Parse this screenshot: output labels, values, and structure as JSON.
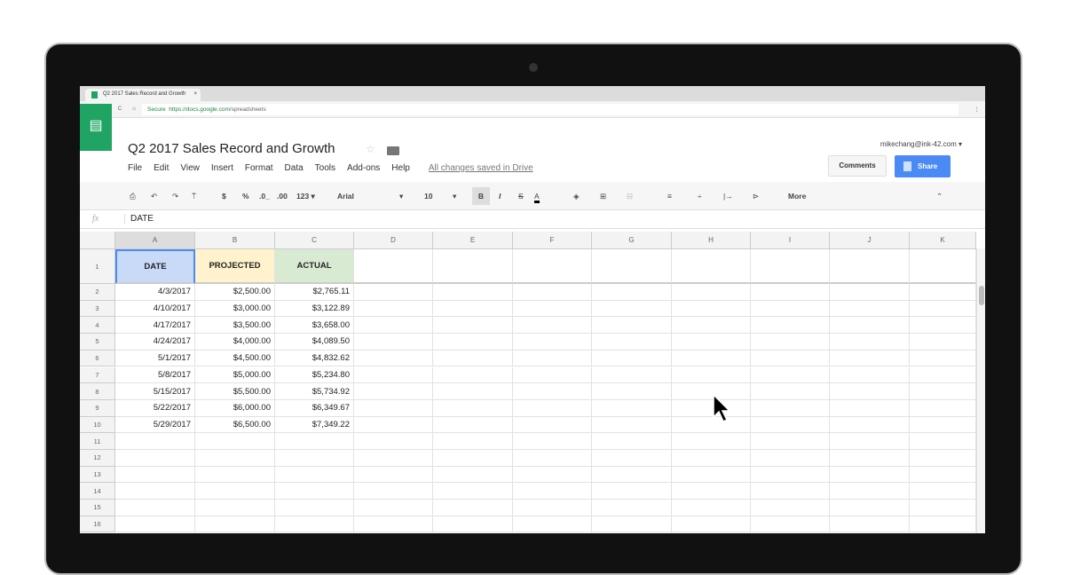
{
  "browser": {
    "tab_title": "Q2 2017 Sales Record and Growth",
    "secure": "Secure",
    "url_host": "https://docs.google.com",
    "url_path": "/spreadsheets"
  },
  "doc": {
    "title": "Q2 2017 Sales Record and Growth",
    "saved_status": "All changes saved in Drive",
    "user": "mikechang@ink-42.com",
    "comments": "Comments",
    "share": "Share"
  },
  "menus": [
    "File",
    "Edit",
    "View",
    "Insert",
    "Format",
    "Data",
    "Tools",
    "Add-ons",
    "Help"
  ],
  "toolbar": {
    "currency": "$",
    "percent": "%",
    "dec_down": ".0_",
    "dec_up": ".00",
    "format": "123 ▾",
    "font": "Arial",
    "size": "10",
    "bold": "B",
    "italic": "I",
    "strike": "S",
    "color": "A",
    "more": "More"
  },
  "formula": {
    "label": "fx",
    "value": "DATE"
  },
  "columns": [
    "A",
    "B",
    "C",
    "D",
    "E",
    "F",
    "G",
    "H",
    "I",
    "J",
    "K"
  ],
  "headers": [
    "DATE",
    "PROJECTED",
    "ACTUAL"
  ],
  "header_colors": [
    "#c9daf8",
    "#fff2cc",
    "#d9ead3"
  ],
  "rows": [
    [
      "4/3/2017",
      "$2,500.00",
      "$2,765.11"
    ],
    [
      "4/10/2017",
      "$3,000.00",
      "$3,122.89"
    ],
    [
      "4/17/2017",
      "$3,500.00",
      "$3,658.00"
    ],
    [
      "4/24/2017",
      "$4,000.00",
      "$4,089.50"
    ],
    [
      "5/1/2017",
      "$4,500.00",
      "$4,832.62"
    ],
    [
      "5/8/2017",
      "$5,000.00",
      "$5,234.80"
    ],
    [
      "5/15/2017",
      "$5,500.00",
      "$5,734.92"
    ],
    [
      "5/22/2017",
      "$6,000.00",
      "$6,349.67"
    ],
    [
      "5/29/2017",
      "$6,500.00",
      "$7,349.22"
    ]
  ],
  "row_numbers": [
    "1",
    "2",
    "3",
    "4",
    "5",
    "6",
    "7",
    "8",
    "9",
    "10",
    "11",
    "12",
    "13",
    "14",
    "15",
    "16"
  ]
}
